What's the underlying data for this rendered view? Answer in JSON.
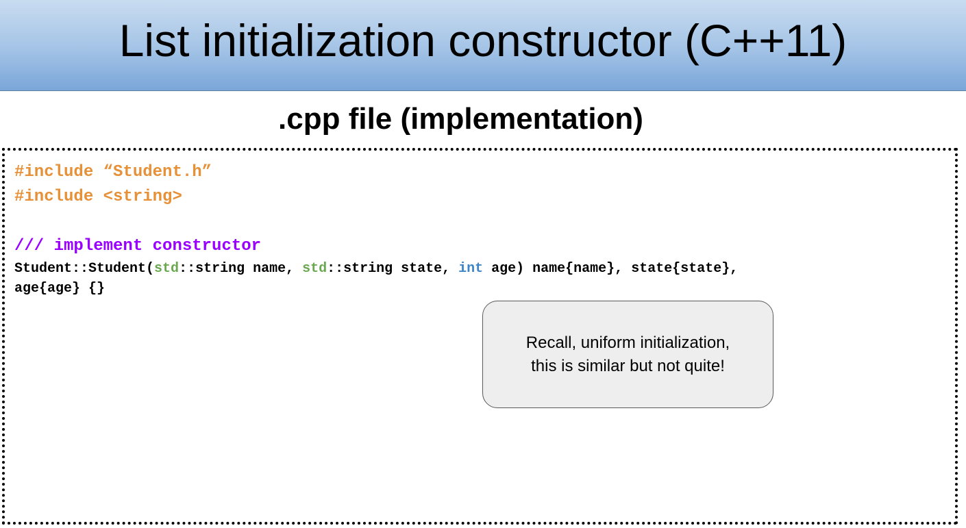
{
  "slide": {
    "title": "List initialization constructor (C++11)",
    "section_heading": ".cpp file (implementation)"
  },
  "code": {
    "include_1": "#include “Student.h”",
    "include_2": "#include <string>",
    "comment": "/// implement constructor",
    "line_4": {
      "part1": "Student::Student(",
      "ns1": "std",
      "part2": "::string name, ",
      "ns2": "std",
      "part3": "::string state, ",
      "type": "int",
      "part4": " age) name{name}, state{state},"
    },
    "line_5": "age{age} {}"
  },
  "callout": {
    "line_1": "Recall, uniform initialization,",
    "line_2": "this is similar but not quite!"
  },
  "colors": {
    "include": "#e69138",
    "comment": "#9900ff",
    "namespace": "#6aa84f",
    "keyword_type": "#3d85c6",
    "title_gradient_top": "#c9dcf0",
    "title_gradient_bottom": "#7aa6d8",
    "callout_fill": "#eeeeee"
  }
}
